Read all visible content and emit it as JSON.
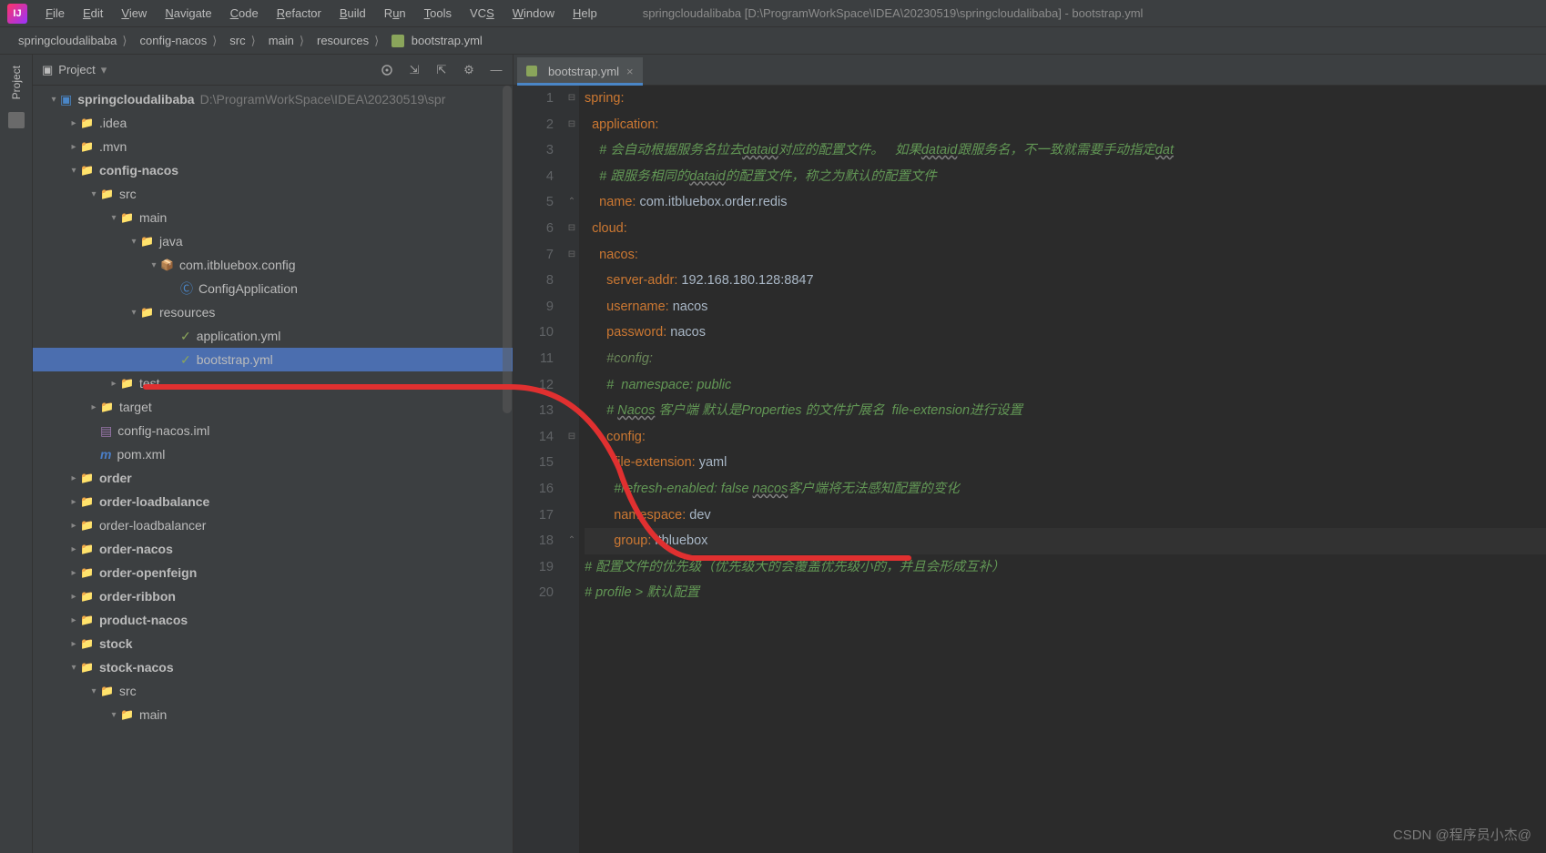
{
  "menubar": {
    "items": [
      "File",
      "Edit",
      "View",
      "Navigate",
      "Code",
      "Refactor",
      "Build",
      "Run",
      "Tools",
      "VCS",
      "Window",
      "Help"
    ]
  },
  "window_title": "springcloudalibaba [D:\\ProgramWorkSpace\\IDEA\\20230519\\springcloudalibaba] - bootstrap.yml",
  "breadcrumb": [
    "springcloudalibaba",
    "config-nacos",
    "src",
    "main",
    "resources",
    "bootstrap.yml"
  ],
  "sidebar": {
    "title": "Project",
    "root": {
      "name": "springcloudalibaba",
      "path": "D:\\ProgramWorkSpace\\IDEA\\20230519\\spr"
    },
    "tree": [
      {
        "indent": 0,
        "chev": "v",
        "icon": "module",
        "label": "springcloudalibaba",
        "module": true,
        "path": "D:\\ProgramWorkSpace\\IDEA\\20230519\\spr"
      },
      {
        "indent": 1,
        "chev": ">",
        "icon": "folder",
        "label": ".idea"
      },
      {
        "indent": 1,
        "chev": ">",
        "icon": "folder",
        "label": ".mvn"
      },
      {
        "indent": 1,
        "chev": "v",
        "icon": "folder-mod",
        "label": "config-nacos",
        "module": true
      },
      {
        "indent": 2,
        "chev": "v",
        "icon": "folder",
        "label": "src"
      },
      {
        "indent": 3,
        "chev": "v",
        "icon": "folder",
        "label": "main"
      },
      {
        "indent": 4,
        "chev": "v",
        "icon": "folder",
        "label": "java"
      },
      {
        "indent": 5,
        "chev": "v",
        "icon": "package",
        "label": "com.itbluebox.config"
      },
      {
        "indent": 6,
        "chev": "",
        "icon": "class",
        "label": "ConfigApplication"
      },
      {
        "indent": 4,
        "chev": "v",
        "icon": "resources",
        "label": "resources"
      },
      {
        "indent": 6,
        "chev": "",
        "icon": "yml",
        "label": "application.yml"
      },
      {
        "indent": 6,
        "chev": "",
        "icon": "yml",
        "label": "bootstrap.yml",
        "selected": true
      },
      {
        "indent": 3,
        "chev": ">",
        "icon": "folder",
        "label": "test",
        "special": true
      },
      {
        "indent": 2,
        "chev": ">",
        "icon": "folder",
        "label": "target",
        "special": true
      },
      {
        "indent": 2,
        "chev": "",
        "icon": "iml",
        "label": "config-nacos.iml"
      },
      {
        "indent": 2,
        "chev": "",
        "icon": "pom",
        "label": "pom.xml"
      },
      {
        "indent": 1,
        "chev": ">",
        "icon": "folder-mod",
        "label": "order",
        "module": true
      },
      {
        "indent": 1,
        "chev": ">",
        "icon": "folder-mod",
        "label": "order-loadbalance",
        "module": true
      },
      {
        "indent": 1,
        "chev": ">",
        "icon": "folder",
        "label": "order-loadbalancer"
      },
      {
        "indent": 1,
        "chev": ">",
        "icon": "folder-mod",
        "label": "order-nacos",
        "module": true
      },
      {
        "indent": 1,
        "chev": ">",
        "icon": "folder-mod",
        "label": "order-openfeign",
        "module": true
      },
      {
        "indent": 1,
        "chev": ">",
        "icon": "folder-mod",
        "label": "order-ribbon",
        "module": true
      },
      {
        "indent": 1,
        "chev": ">",
        "icon": "folder-mod",
        "label": "product-nacos",
        "module": true
      },
      {
        "indent": 1,
        "chev": ">",
        "icon": "folder-mod",
        "label": "stock",
        "module": true
      },
      {
        "indent": 1,
        "chev": "v",
        "icon": "folder-mod",
        "label": "stock-nacos",
        "module": true
      },
      {
        "indent": 2,
        "chev": "v",
        "icon": "folder",
        "label": "src"
      },
      {
        "indent": 3,
        "chev": "v",
        "icon": "folder",
        "label": "main"
      }
    ]
  },
  "tab": {
    "label": "bootstrap.yml"
  },
  "editor": {
    "lines": [
      {
        "n": 1,
        "fold": "-",
        "html": "<span class='k'>spring</span><span class='colon'>:</span>"
      },
      {
        "n": 2,
        "fold": "-",
        "html": "  <span class='k'>application</span><span class='colon'>:</span>"
      },
      {
        "n": 3,
        "fold": "",
        "html": "    <span class='c'># 会自动根据服务名拉去</span><span class='cu'>dataid</span><span class='c'>对应的配置文件。   如果</span><span class='cu'>dataid</span><span class='c'>跟服务名，不一致就需要手动指定</span><span class='cu'>dat</span>"
      },
      {
        "n": 4,
        "fold": "",
        "html": "    <span class='c'># 跟服务相同的</span><span class='cu'>dataid</span><span class='c'>的配置文件，称之为默认的配置文件</span>"
      },
      {
        "n": 5,
        "fold": "^",
        "html": "    <span class='k'>name</span><span class='colon'>:</span> <span class='v'>com.itbluebox.order.redis</span>"
      },
      {
        "n": 6,
        "fold": "-",
        "html": "  <span class='k'>cloud</span><span class='colon'>:</span>"
      },
      {
        "n": 7,
        "fold": "-",
        "html": "    <span class='k'>nacos</span><span class='colon'>:</span>"
      },
      {
        "n": 8,
        "fold": "",
        "html": "      <span class='k'>server-addr</span><span class='colon'>:</span> <span class='v'>192.168.180.128:8847</span>"
      },
      {
        "n": 9,
        "fold": "",
        "html": "      <span class='k'>username</span><span class='colon'>:</span> <span class='v'>nacos</span>"
      },
      {
        "n": 10,
        "fold": "",
        "html": "      <span class='k'>password</span><span class='colon'>:</span> <span class='v'>nacos</span>"
      },
      {
        "n": 11,
        "fold": "",
        "html": "      <span class='h'>#config:</span>"
      },
      {
        "n": 12,
        "fold": "",
        "html": "      <span class='c'>#  namespace: public</span>"
      },
      {
        "n": 13,
        "fold": "",
        "html": "      <span class='c'># </span><span class='cu'>Nacos</span><span class='c'> 客户端 默认是Properties 的文件扩展名  file-extension进行设置</span>"
      },
      {
        "n": 14,
        "fold": "-",
        "html": "      <span class='k'>config</span><span class='colon'>:</span>"
      },
      {
        "n": 15,
        "fold": "",
        "html": "        <span class='k'>file-extension</span><span class='colon'>:</span> <span class='v'>yaml</span>"
      },
      {
        "n": 16,
        "fold": "",
        "html": "        <span class='c'>#refresh-enabled: false </span><span class='cu'>nacos</span><span class='c'>客户端将无法感知配置的变化</span>"
      },
      {
        "n": 17,
        "fold": "",
        "html": "        <span class='k'>namespace</span><span class='colon'>:</span> <span class='v'>dev</span>"
      },
      {
        "n": 18,
        "fold": "^",
        "html": "        <span class='k'>group</span><span class='colon'>:</span> <span class='v'>itbluebox</span>",
        "current": true
      },
      {
        "n": 19,
        "fold": "",
        "html": "<span class='c'># 配置文件的优先级（优先级大的会覆盖优先级小的，并且会形成互补）</span>"
      },
      {
        "n": 20,
        "fold": "",
        "html": "<span class='c'># profile &gt; 默认配置</span>"
      }
    ]
  },
  "left_tool": {
    "label": "Project"
  },
  "watermark": "CSDN @程序员小杰@"
}
